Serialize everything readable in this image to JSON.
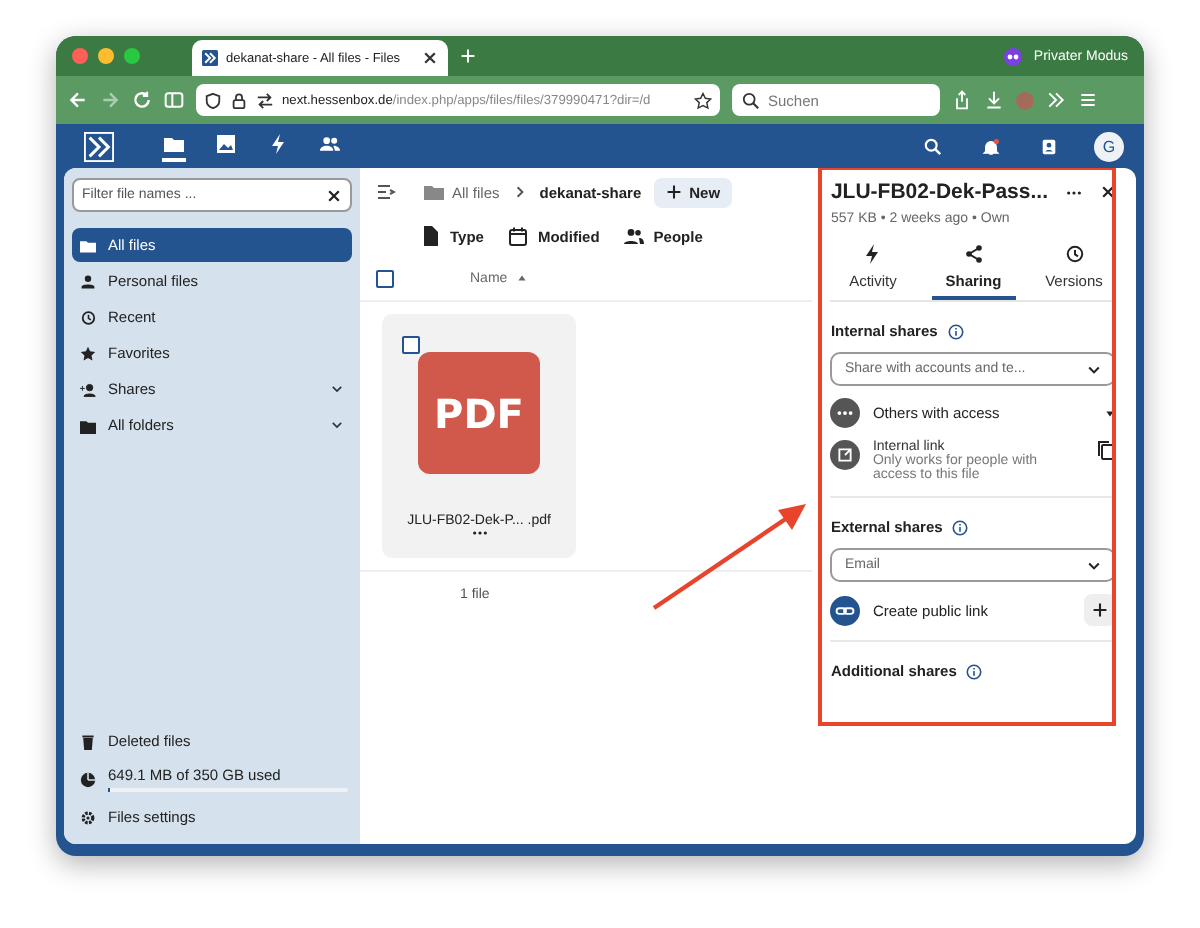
{
  "browser": {
    "tab_title": "dekanat-share - All files - Files",
    "private_mode": "Privater Modus",
    "url_host": "next.hessenbox.de",
    "url_path": "/index.php/apps/files/files/379990471?dir=/d",
    "search_placeholder": "Suchen"
  },
  "app_header": {
    "nav": [
      {
        "selected": true
      },
      {
        "selected": false
      },
      {
        "selected": false
      },
      {
        "selected": false
      }
    ],
    "avatar_letter": "G"
  },
  "sidebar": {
    "filter_placeholder": "Filter file names ...",
    "items": [
      {
        "label": "All files",
        "selected": true,
        "expandable": false
      },
      {
        "label": "Personal files",
        "selected": false,
        "expandable": false
      },
      {
        "label": "Recent",
        "selected": false,
        "expandable": false
      },
      {
        "label": "Favorites",
        "selected": false,
        "expandable": false
      },
      {
        "label": "Shares",
        "selected": false,
        "expandable": true
      },
      {
        "label": "All folders",
        "selected": false,
        "expandable": true
      }
    ],
    "deleted": "Deleted files",
    "storage": {
      "text": "649.1 MB of 350 GB used",
      "level": 0.002
    },
    "settings": "Files settings"
  },
  "main": {
    "breadcrumbs": [
      "All files",
      "dekanat-share"
    ],
    "new_button": "New",
    "filters": [
      "Type",
      "Modified",
      "People"
    ],
    "column": "Name",
    "all_checked": false,
    "files": [
      {
        "name": "JLU-FB02-Dek-P... .pdf",
        "icon_text": "PDF",
        "checked": false
      }
    ],
    "summary": "1 file"
  },
  "panel": {
    "title": "JLU-FB02-Dek-Pass...",
    "meta": "557 KB • 2 weeks ago • Own",
    "tabs": [
      {
        "label": "Activity",
        "selected": false
      },
      {
        "label": "Sharing",
        "selected": true
      },
      {
        "label": "Versions",
        "selected": false
      }
    ],
    "internal": {
      "heading": "Internal shares",
      "placeholder": "Share with accounts and te...",
      "others": "Others with access",
      "link_title": "Internal link",
      "link_desc": "Only works for people with access to this file"
    },
    "external": {
      "heading": "External shares",
      "placeholder": "Email",
      "public_link": "Create public link"
    },
    "additional": {
      "heading": "Additional shares"
    }
  }
}
